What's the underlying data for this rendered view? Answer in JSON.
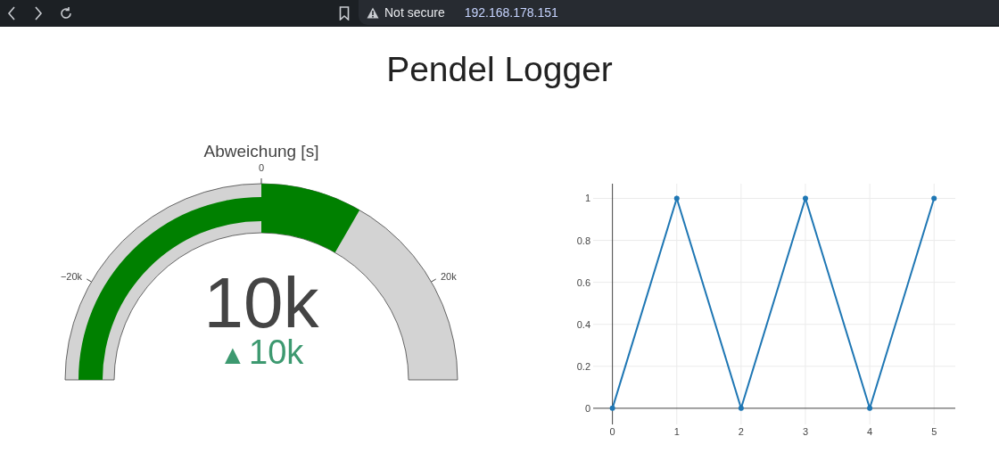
{
  "browser": {
    "security_label": "Not secure",
    "url": "192.168.178.151"
  },
  "page": {
    "title": "Pendel Logger"
  },
  "gauge": {
    "title": "Abweichung [s]",
    "ticks": [
      {
        "label": "−20k"
      },
      {
        "label": "0"
      },
      {
        "label": "20k"
      }
    ],
    "value": "10k",
    "delta_icon": "▲",
    "delta": "10k"
  },
  "chart": {
    "chart_data": {
      "type": "line",
      "x": [
        0,
        1,
        2,
        3,
        4,
        5
      ],
      "series": [
        {
          "color": "#1f77b4",
          "marker": true,
          "values": [
            0,
            1,
            0,
            1,
            0,
            1
          ]
        }
      ],
      "grid": true,
      "xlim": [
        -0.3,
        5.33
      ],
      "ylim": [
        -0.077,
        1.07
      ],
      "xticks": [
        0,
        1,
        2,
        3,
        4,
        5
      ],
      "yticks": [
        0,
        0.2,
        0.4,
        0.6,
        0.8,
        1
      ]
    }
  }
}
